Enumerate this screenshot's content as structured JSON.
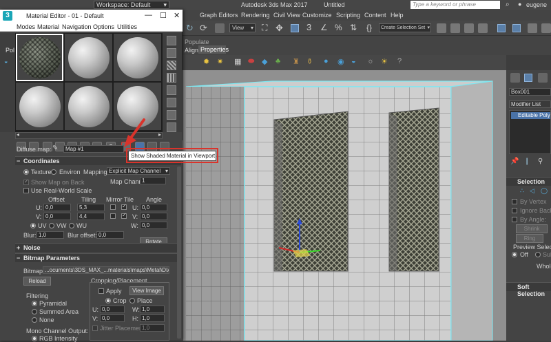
{
  "app": {
    "workspace_label": "Workspace: Default",
    "title": "Autodesk 3ds Max 2017",
    "doc": "Untitled",
    "search_placeholder": "Type a keyword or phrase",
    "user": "eugene"
  },
  "menus": [
    "Graph Editors",
    "Rendering",
    "Civil View",
    "Customize",
    "Scripting",
    "Content",
    "Help"
  ],
  "toolbar": {
    "view_dropdown": "View",
    "selection_set": "Create Selection Set"
  },
  "ribbon": {
    "populate_tab": "Populate",
    "tabs": [
      "Align",
      "Properties"
    ]
  },
  "material_editor": {
    "title": "Material Editor - 01 - Default",
    "menus": [
      "Modes",
      "Material",
      "Navigation",
      "Options",
      "Utilities"
    ],
    "side_label": "Pol",
    "diffuse_label": "Diffuse map:",
    "map_name": "Map #1",
    "tooltip": "Show Shaded Material in Viewport",
    "coordinates": {
      "header": "Coordinates",
      "texture": "Texture",
      "environ": "Environ",
      "mapping_label": "Mapping:",
      "mapping_value": "Explicit Map Channel",
      "map_channel_label": "Map Channel:",
      "map_channel_value": "1",
      "show_map_on_back": "Show Map on Back",
      "real_world": "Use Real-World Scale",
      "offset_label": "Offset",
      "tiling_label": "Tiling",
      "mirror_tile_label": "Mirror Tile",
      "angle_label": "Angle",
      "u_label": "U:",
      "v_label": "V:",
      "w_label": "W:",
      "u_offset": "0,0",
      "v_offset": "0,0",
      "u_tiling": "5,3",
      "v_tiling": "4,4",
      "u_angle": "0,0",
      "v_angle": "0,0",
      "w_angle": "0,0",
      "uv": "UV",
      "vw": "VW",
      "wu": "WU",
      "blur_label": "Blur:",
      "blur_value": "1,0",
      "blur_offset_label": "Blur offset:",
      "blur_offset_value": "0,0",
      "rotate": "Rotate"
    },
    "noise_header": "Noise",
    "bitmap": {
      "header": "Bitmap Parameters",
      "bitmap_label": "Bitmap:",
      "path": "...ocuments\\3DS_MAX_...materials\\maps\\Metal\\DIAMOND2.JPG",
      "reload": "Reload",
      "cropping_header": "Cropping/Placement",
      "apply": "Apply",
      "view_image": "View Image",
      "crop": "Crop",
      "place": "Place",
      "u_label": "U:",
      "v_label": "V:",
      "w_label": "W:",
      "h_label": "H:",
      "u_value": "0,0",
      "v_value": "0,0",
      "w_value": "1,0",
      "h_value": "1,0",
      "jitter_label": "Jitter Placement:",
      "jitter_value": "1,0",
      "filtering_header": "Filtering",
      "pyramidal": "Pyramidal",
      "summed_area": "Summed Area",
      "none": "None",
      "mono_header": "Mono Channel Output:",
      "rgb_intensity": "RGB Intensity"
    }
  },
  "command_panel": {
    "object_name": "Box001",
    "modifier_list": "Modifier List",
    "stack_item": "Editable Poly",
    "selection_header": "Selection",
    "by_vertex": "By Vertex",
    "ignore_backfacing": "Ignore Backfacing",
    "by_angle": "By Angle:",
    "shrink": "Shrink",
    "ring": "Ring",
    "preview_selection": "Preview Selection",
    "off": "Off",
    "sub": "Sub",
    "whole": "Whole",
    "soft_selection_header": "Soft Selection"
  },
  "colors": {
    "accent": "#5a9fd4",
    "selection_cyan": "#6ee6f0",
    "highlight_red": "#d9342c"
  }
}
